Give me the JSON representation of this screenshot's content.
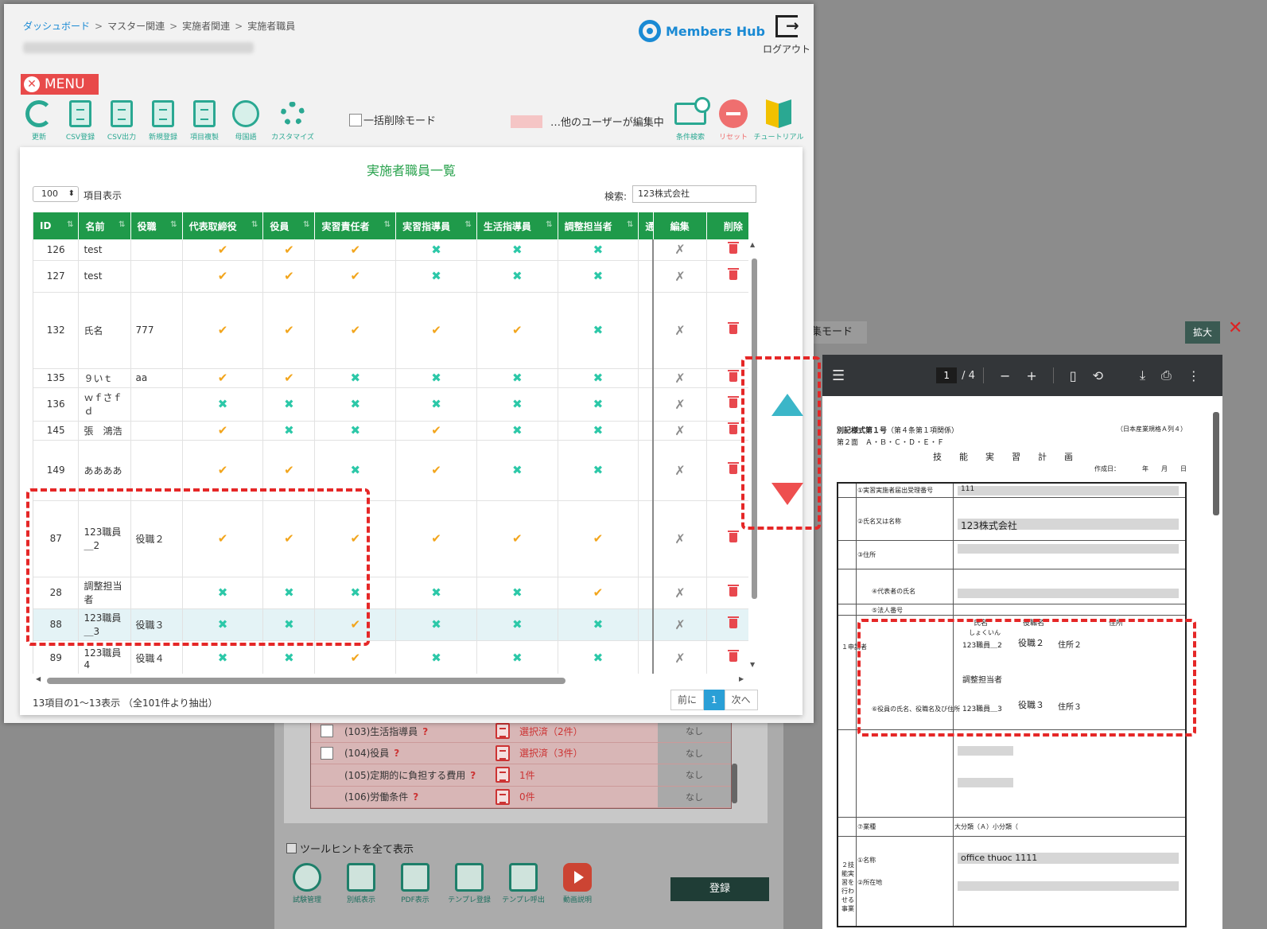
{
  "breadcrumb": [
    "ダッシュボード",
    "マスター関連",
    "実施者関連",
    "実施者職員"
  ],
  "logo": "Members Hub",
  "logout_label": "ログアウト",
  "menu_label": "MENU",
  "toolbar": [
    "更新",
    "CSV登録",
    "CSV出力",
    "新規登録",
    "項目複製",
    "母国語",
    "カスタマイズ"
  ],
  "bulk_delete_label": "一括削除モード",
  "editing_label": "…他のユーザーが編集中",
  "right_tools": [
    "条件検索",
    "リセット",
    "チュートリアル"
  ],
  "panel_title": "実施者職員一覧",
  "page_size": "100",
  "page_size_label": "項目表示",
  "search_label": "検索:",
  "search_value": "123株式会社",
  "columns": [
    "ID",
    "名前",
    "役職",
    "代表取締役",
    "役員",
    "実習責任者",
    "実習指導員",
    "生活指導員",
    "調整担当者",
    "通",
    "編集",
    "削除"
  ],
  "rows": [
    {
      "id": "126",
      "name": "test",
      "role": "",
      "marks": [
        "ok",
        "ok",
        "ok",
        "ng",
        "ng",
        "ng"
      ],
      "h": 26
    },
    {
      "id": "127",
      "name": "test",
      "role": "",
      "marks": [
        "ok",
        "ok",
        "ok",
        "ng",
        "ng",
        "ng"
      ],
      "h": 40
    },
    {
      "id": "132",
      "name": "氏名",
      "role": "777",
      "marks": [
        "ok",
        "ok",
        "ok",
        "ok",
        "ok",
        "ng"
      ],
      "h": 96
    },
    {
      "id": "135",
      "name": "９いｔ",
      "role": "aa",
      "marks": [
        "ok",
        "ok",
        "ng",
        "ng",
        "ng",
        "ng"
      ],
      "h": 24
    },
    {
      "id": "136",
      "name": "ｗｆさｆｄ",
      "role": "",
      "marks": [
        "ng",
        "ng",
        "ng",
        "ng",
        "ng",
        "ng"
      ],
      "h": 42
    },
    {
      "id": "145",
      "name": "張　鴻浩",
      "role": "",
      "marks": [
        "ok",
        "ng",
        "ng",
        "ok",
        "ng",
        "ng"
      ],
      "h": 24
    },
    {
      "id": "149",
      "name": "ああああ",
      "role": "",
      "marks": [
        "ok",
        "ok",
        "ng",
        "ok",
        "ng",
        "ng"
      ],
      "h": 76
    },
    {
      "id": "87",
      "name": "123職員＿2",
      "role": "役職２",
      "marks": [
        "ok",
        "ok",
        "ok",
        "ok",
        "ok",
        "ok"
      ],
      "h": 96
    },
    {
      "id": "28",
      "name": "調整担当者",
      "role": "",
      "marks": [
        "ng",
        "ng",
        "ng",
        "ng",
        "ng",
        "ok"
      ],
      "h": 40
    },
    {
      "id": "88",
      "name": "123職員＿3",
      "role": "役職３",
      "marks": [
        "ng",
        "ng",
        "ok",
        "ng",
        "ng",
        "ng"
      ],
      "h": 40,
      "highlight": true
    },
    {
      "id": "89",
      "name": "123職員4",
      "role": "役職４",
      "marks": [
        "ng",
        "ng",
        "ok",
        "ng",
        "ng",
        "ng"
      ],
      "h": 44
    }
  ],
  "footer_info": "13項目の1〜13表示 （全101件より抽出）",
  "pager": {
    "prev": "前に",
    "current": "1",
    "next": "次へ"
  },
  "background_form": {
    "rows": [
      {
        "name": "(103)生活指導員",
        "status": "選択済（2件）",
        "none": "なし",
        "checkbox": true
      },
      {
        "name": "(104)役員",
        "status": "選択済（3件）",
        "none": "なし",
        "checkbox": true
      },
      {
        "name": "(105)定期的に負担する費用",
        "status": "1件",
        "none": "なし",
        "checkbox": false
      },
      {
        "name": "(106)労働条件",
        "status": "0件",
        "none": "なし",
        "checkbox": false
      }
    ],
    "tooltip_label": "ツールヒントを全て表示",
    "tools": [
      "試験管理",
      "別紙表示",
      "PDF表示",
      "テンプレ登録",
      "テンプレ呼出",
      "動画説明"
    ],
    "register_label": "登録"
  },
  "pdf_panel": {
    "mode_label": "集モード",
    "expand_label": "拡大",
    "page": "1",
    "total": "/ 4",
    "doc_header": "別記様式第１号",
    "doc_header_sub": "（第４条第１項関係）",
    "doc_header_right": "（日本産業規格Ａ列４）",
    "doc_sheet": "第２面　Ａ・Ｂ・Ｃ・Ｄ・Ｅ・Ｆ",
    "doc_title": "技能実習計画",
    "doc_date": "作成日：　　　　年　　月　　日",
    "field_no": "①実習実施者届出受理番号",
    "field_no_val": "111",
    "field_name": "②氏名又は名称",
    "field_name_val": "123株式会社",
    "field_addr": "③住所",
    "field_rep": "④代表者の氏名",
    "field_corp": "⑤法人番号",
    "field_officers": "⑥役員の氏名、役職名及び住所",
    "col_name": "氏名",
    "col_role": "役職名",
    "col_addr": "住所",
    "officer1_kana": "しょくいん",
    "officer1_name": "123職員＿2",
    "officer1_role": "役職２",
    "officer1_addr": "住所２",
    "officer2_name": "調整担当者",
    "officer3_name": "123職員＿3",
    "officer3_role": "役職３",
    "officer3_addr": "住所３",
    "field_industry": "⑦業種",
    "industry_val": "大分類（Ａ）小分類（",
    "applicant_label": "１申請者",
    "section2_label": "２技能実習を行わせる事業",
    "section2_name": "①名称",
    "section2_name_val": "office thuoc 1111",
    "section2_addr": "②所在地"
  }
}
